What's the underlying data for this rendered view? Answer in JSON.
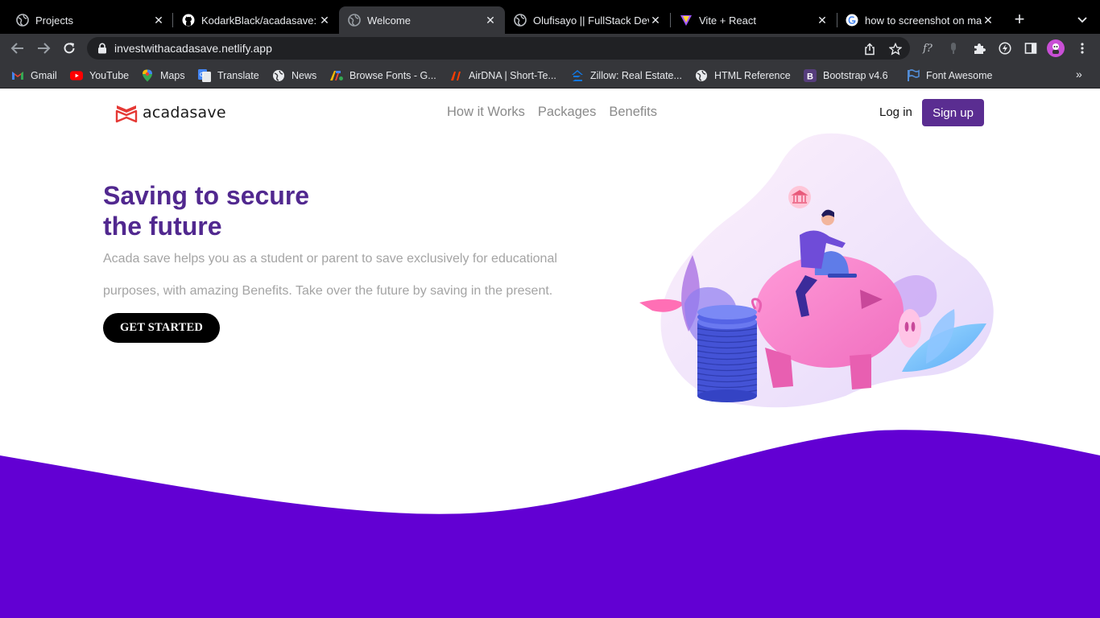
{
  "browser": {
    "tabs": [
      {
        "title": "Projects",
        "icon": "globe-icon",
        "active": false
      },
      {
        "title": "KodarkBlack/acadasave:",
        "icon": "github-icon",
        "active": false
      },
      {
        "title": "Welcome",
        "icon": "globe-icon",
        "active": true
      },
      {
        "title": "Olufisayo || FullStack Dev",
        "icon": "globe-icon",
        "active": false
      },
      {
        "title": "Vite + React",
        "icon": "vite-icon",
        "active": false
      },
      {
        "title": "how to screenshot on ma",
        "icon": "google-icon",
        "active": false
      }
    ],
    "url": "investwithacadasave.netlify.app",
    "bookmarks": [
      {
        "label": "Gmail",
        "icon": "gmail-icon"
      },
      {
        "label": "YouTube",
        "icon": "youtube-icon"
      },
      {
        "label": "Maps",
        "icon": "maps-icon"
      },
      {
        "label": "Translate",
        "icon": "translate-icon"
      },
      {
        "label": "News",
        "icon": "globe-icon"
      },
      {
        "label": "Browse Fonts - G...",
        "icon": "google-fonts-icon"
      },
      {
        "label": "AirDNA | Short-Te...",
        "icon": "airdna-icon"
      },
      {
        "label": "Zillow: Real Estate...",
        "icon": "zillow-icon"
      },
      {
        "label": "HTML Reference",
        "icon": "globe-icon"
      },
      {
        "label": "Bootstrap v4.6",
        "icon": "bootstrap-icon"
      },
      {
        "label": "Font Awesome",
        "icon": "flag-icon"
      }
    ],
    "more_bookmarks": "»",
    "extension_font_label": "f?"
  },
  "site": {
    "brand": "acadasave",
    "nav": {
      "how_it_works": "How it Works",
      "packages": "Packages",
      "benefits": "Benefits"
    },
    "login": "Log in",
    "signup": "Sign up",
    "hero": {
      "title_line1": "Saving to secure",
      "title_line2": "the future",
      "text": "Acada save helps you as a student or parent to save exclusively for educational purposes, with amazing Benefits. Take over the future by saving in the present.",
      "cta": "GET STARTED"
    }
  },
  "colors": {
    "brand_purple": "#51288f",
    "signup_bg": "#5a2d91",
    "wave": "#6200d3",
    "logo_red": "#e53935",
    "chrome_dark": "#35363a"
  }
}
